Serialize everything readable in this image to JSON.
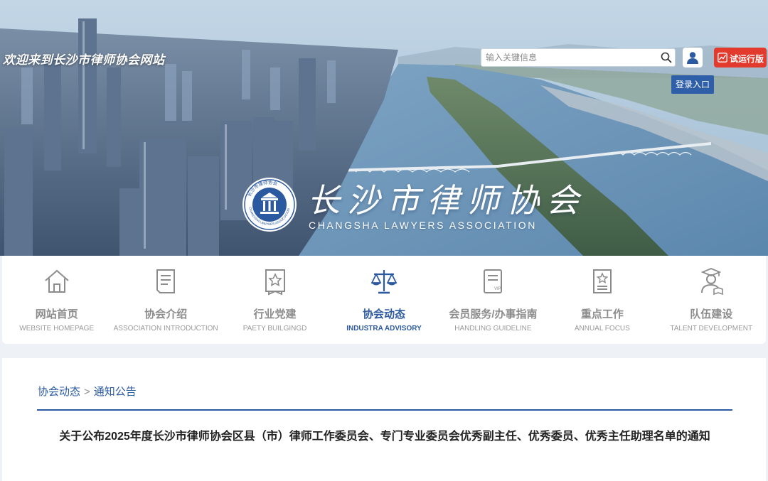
{
  "header": {
    "welcome_text": "欢迎来到长沙市律师协会网站",
    "search": {
      "placeholder": "输入关键信息",
      "value": ""
    },
    "trial_badge": "试运行版",
    "login_label": "登录入口"
  },
  "logo": {
    "chinese_name": "长沙市律师协会",
    "english_name": "CHANGSHA LAWYERS ASSOCIATION",
    "emblem_text": "长沙市律师协会 CHANGSHA LAWYERS ASSOCIATION"
  },
  "nav": {
    "items": [
      {
        "cn": "网站首页",
        "en": "WEBSITE HOMEPAGE",
        "icon": "home-icon",
        "active": false
      },
      {
        "cn": "协会介绍",
        "en": "ASSOCIATION INTRODUCTION",
        "icon": "document-icon",
        "active": false
      },
      {
        "cn": "行业党建",
        "en": "PAETY BUILGINGD",
        "icon": "badge-icon",
        "active": false
      },
      {
        "cn": "协会动态",
        "en": "INDUSTRA ADVISORY",
        "icon": "scales-icon",
        "active": true
      },
      {
        "cn": "会员服务/办事指南",
        "en": "HANDLING GUIDELINE",
        "icon": "vip-card-icon",
        "active": false
      },
      {
        "cn": "重点工作",
        "en": "ANNUAL FOCUS",
        "icon": "certificate-icon",
        "active": false
      },
      {
        "cn": "队伍建设",
        "en": "TALENT DEVELOPMENT",
        "icon": "graduate-icon",
        "active": false
      }
    ]
  },
  "breadcrumb": {
    "section": "协会动态",
    "separator": ">",
    "page": "通知公告"
  },
  "article": {
    "title": "关于公布2025年度长沙市律师协会区县（市）律师工作委员会、专门专业委员会优秀副主任、优秀委员、优秀主任助理名单的通知"
  },
  "colors": {
    "brand_blue": "#2c5aa0",
    "trial_red": "#e23a2d",
    "login_blue": "#2f5fa8",
    "nav_inactive": "#8c8c8c"
  }
}
